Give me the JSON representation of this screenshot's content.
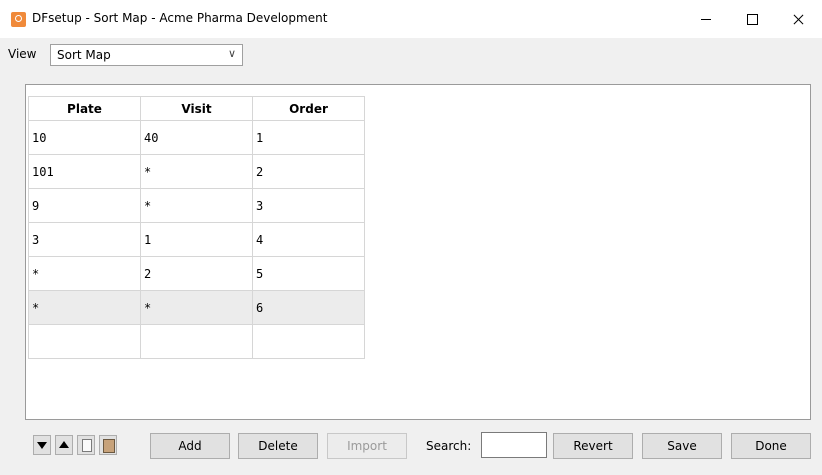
{
  "window": {
    "title": "DFsetup - Sort Map - Acme Pharma Development",
    "minimize": "–",
    "maximize": "☐",
    "close": "✕"
  },
  "view": {
    "label": "View",
    "selected": "Sort Map",
    "chevron": "∨"
  },
  "table": {
    "headers": [
      "Plate",
      "Visit",
      "Order"
    ],
    "rows": [
      [
        "10",
        "40",
        "1"
      ],
      [
        "101",
        "*",
        "2"
      ],
      [
        "9",
        "*",
        "3"
      ],
      [
        "3",
        "1",
        "4"
      ],
      [
        "*",
        "2",
        "5"
      ],
      [
        "*",
        "*",
        "6"
      ],
      [
        "",
        "",
        ""
      ]
    ],
    "selected_row": 5
  },
  "toolbar": {
    "icons": [
      "move-down-icon",
      "move-up-icon",
      "copy-document-icon",
      "paste-document-icon"
    ],
    "add_label": "Add",
    "delete_label": "Delete",
    "import_label": "Import",
    "search_label": "Search:",
    "search_value": "",
    "revert_label": "Revert",
    "save_label": "Save",
    "done_label": "Done"
  },
  "colors": {
    "window_bg": "#f0f0f0",
    "panel_bg": "#ffffff",
    "selected_row_bg": "#ececec",
    "app_icon": "#f08a3a"
  }
}
